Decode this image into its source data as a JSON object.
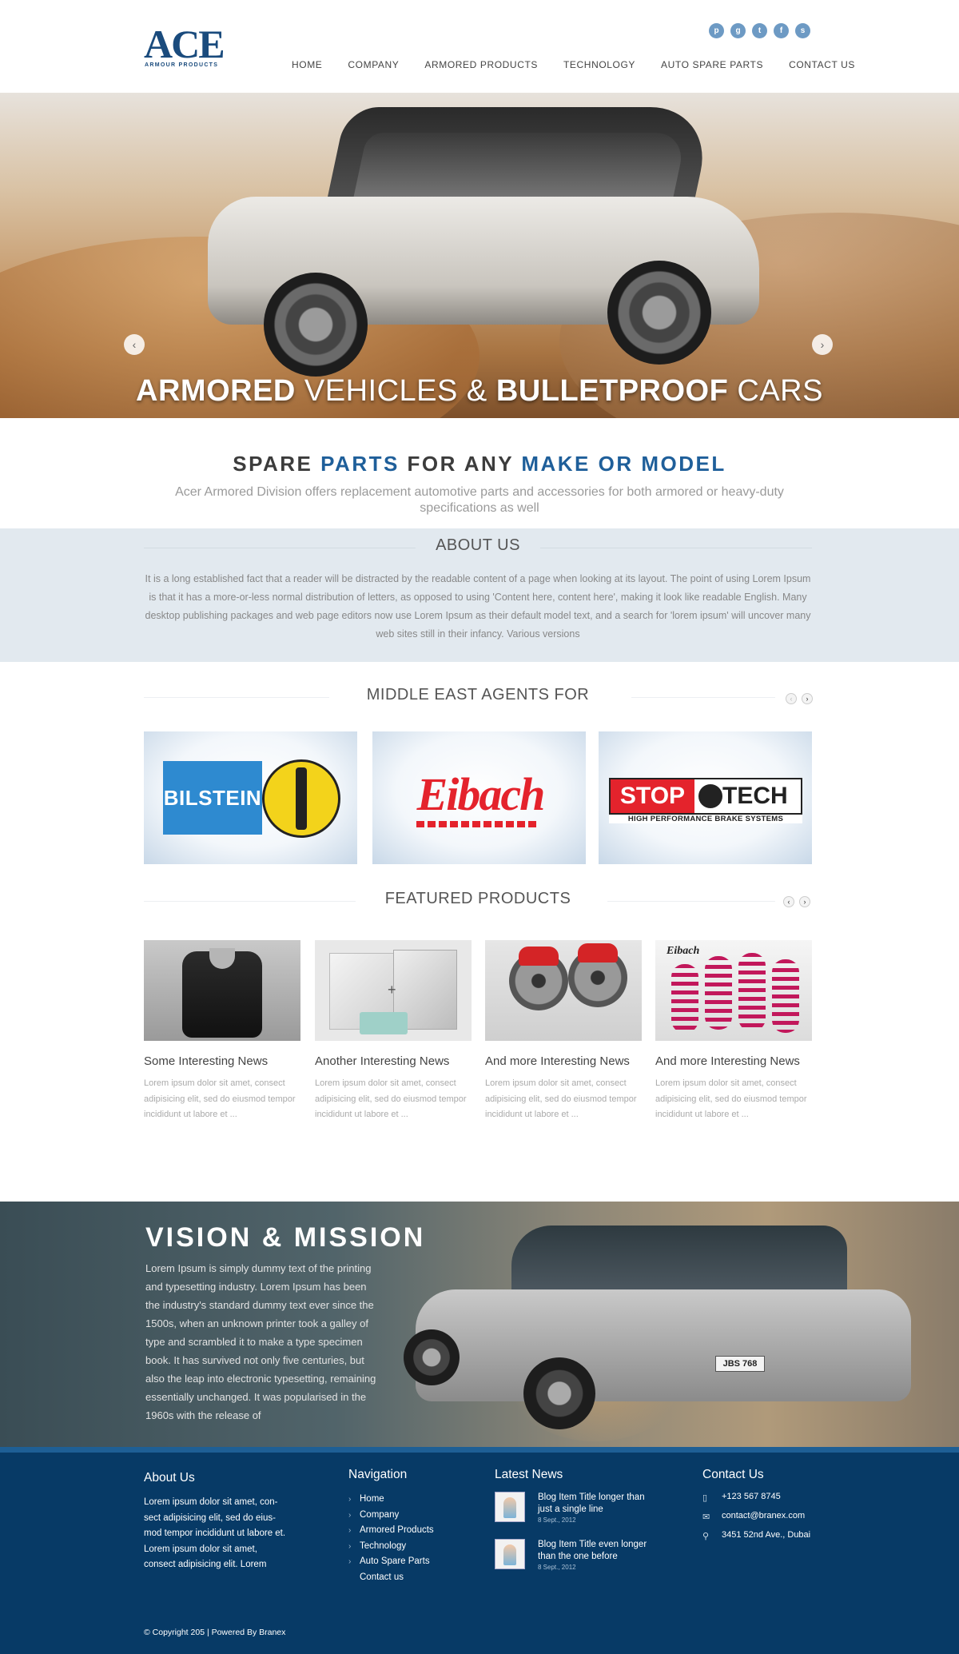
{
  "logo": {
    "name": "ACE",
    "subtitle": "ARMOUR PRODUCTS"
  },
  "social": [
    {
      "icon": "pinterest-icon",
      "glyph": "p"
    },
    {
      "icon": "google-plus-icon",
      "glyph": "g"
    },
    {
      "icon": "twitter-icon",
      "glyph": "t"
    },
    {
      "icon": "facebook-icon",
      "glyph": "f"
    },
    {
      "icon": "skype-icon",
      "glyph": "s"
    }
  ],
  "nav": [
    "HOME",
    "COMPANY",
    "ARMORED PRODUCTS",
    "TECHNOLOGY",
    "AUTO SPARE PARTS",
    "CONTACT US"
  ],
  "hero": {
    "caption_bold1": "ARMORED",
    "caption_mid": " VEHICLES & ",
    "caption_bold2": "BULLETPROOF",
    "caption_end": " CARS",
    "prev_glyph": "‹",
    "next_glyph": "›"
  },
  "tagline": {
    "part1": "SPARE ",
    "part2": "PARTS",
    "part3": " FOR ANY ",
    "part4": "MAKE OR MODEL",
    "subtitle": "Acer Armored Division offers replacement automotive parts and accessories for both armored or heavy-duty specifications as well"
  },
  "about": {
    "title": "ABOUT US",
    "text": "It is a long established fact that a reader will be distracted by the readable content of a page when looking at its layout. The point of using Lorem Ipsum is that it has a more-or-less normal distribution of letters, as opposed to using 'Content here, content here', making it look like readable English. Many desktop publishing packages and web page editors now use Lorem Ipsum as their default model text, and a search for 'lorem ipsum' will uncover many web sites still in their infancy. Various versions"
  },
  "agents": {
    "title": "MIDDLE EAST AGENTS FOR",
    "brands": [
      "BILSTEIN",
      "Eibach",
      "STOP",
      "TECH",
      "HIGH PERFORMANCE BRAKE SYSTEMS"
    ],
    "registered_mark": "®"
  },
  "featured": {
    "title": "FEATURED PRODUCTS",
    "products": [
      {
        "title": "Some Interesting News",
        "text": "Lorem ipsum dolor sit amet, consect adipisicing elit, sed do eiusmod tempor incididunt ut labore et ..."
      },
      {
        "title": "Another Interesting News",
        "text": "Lorem ipsum dolor sit amet, consect adipisicing elit, sed do eiusmod tempor incididunt ut labore et ..."
      },
      {
        "title": "And more Interesting News",
        "text": "Lorem ipsum dolor sit amet, consect adipisicing elit, sed do eiusmod tempor incididunt ut labore et ..."
      },
      {
        "title": "And more Interesting News",
        "text": "Lorem ipsum dolor sit amet, consect adipisicing elit, sed do eiusmod tempor incididunt ut labore et ..."
      }
    ],
    "spring_brand": "Eibach"
  },
  "vision": {
    "title": "VISION & MISSION",
    "text": "Lorem Ipsum is simply dummy text of the printing and typesetting industry. Lorem Ipsum has been the industry's standard dummy text ever since the 1500s, when an unknown printer took a galley of type and scrambled it to make a type specimen book. It has survived not only five centuries, but also the leap into electronic typesetting, remaining essentially unchanged. It was popularised in the 1960s with the release of",
    "plate": "JBS 768"
  },
  "footer": {
    "about_title": "About Us",
    "about_text": "Lorem ipsum dolor sit amet, con-sect adipisicing elit, sed do eius-mod tempor incididunt ut labore et. Lorem ipsum dolor sit amet, consect adipisicing elit. Lorem",
    "nav_title": "Navigation",
    "nav_items": [
      "Home",
      "Company",
      "Armored Products",
      "Technology",
      "Auto Spare Parts",
      "Contact us"
    ],
    "news_title": "Latest News",
    "news": [
      {
        "title": "Blog Item Title longer than just a single line",
        "date": "8 Sept., 2012"
      },
      {
        "title": "Blog Item Title even longer than the one before",
        "date": "8 Sept., 2012"
      }
    ],
    "contact_title": "Contact Us",
    "phone": "+123 567 8745",
    "email": "contact@branex.com",
    "address": "3451 52nd Ave., Dubai",
    "copyright": "© Copyright 205 | Powered By Branex"
  }
}
